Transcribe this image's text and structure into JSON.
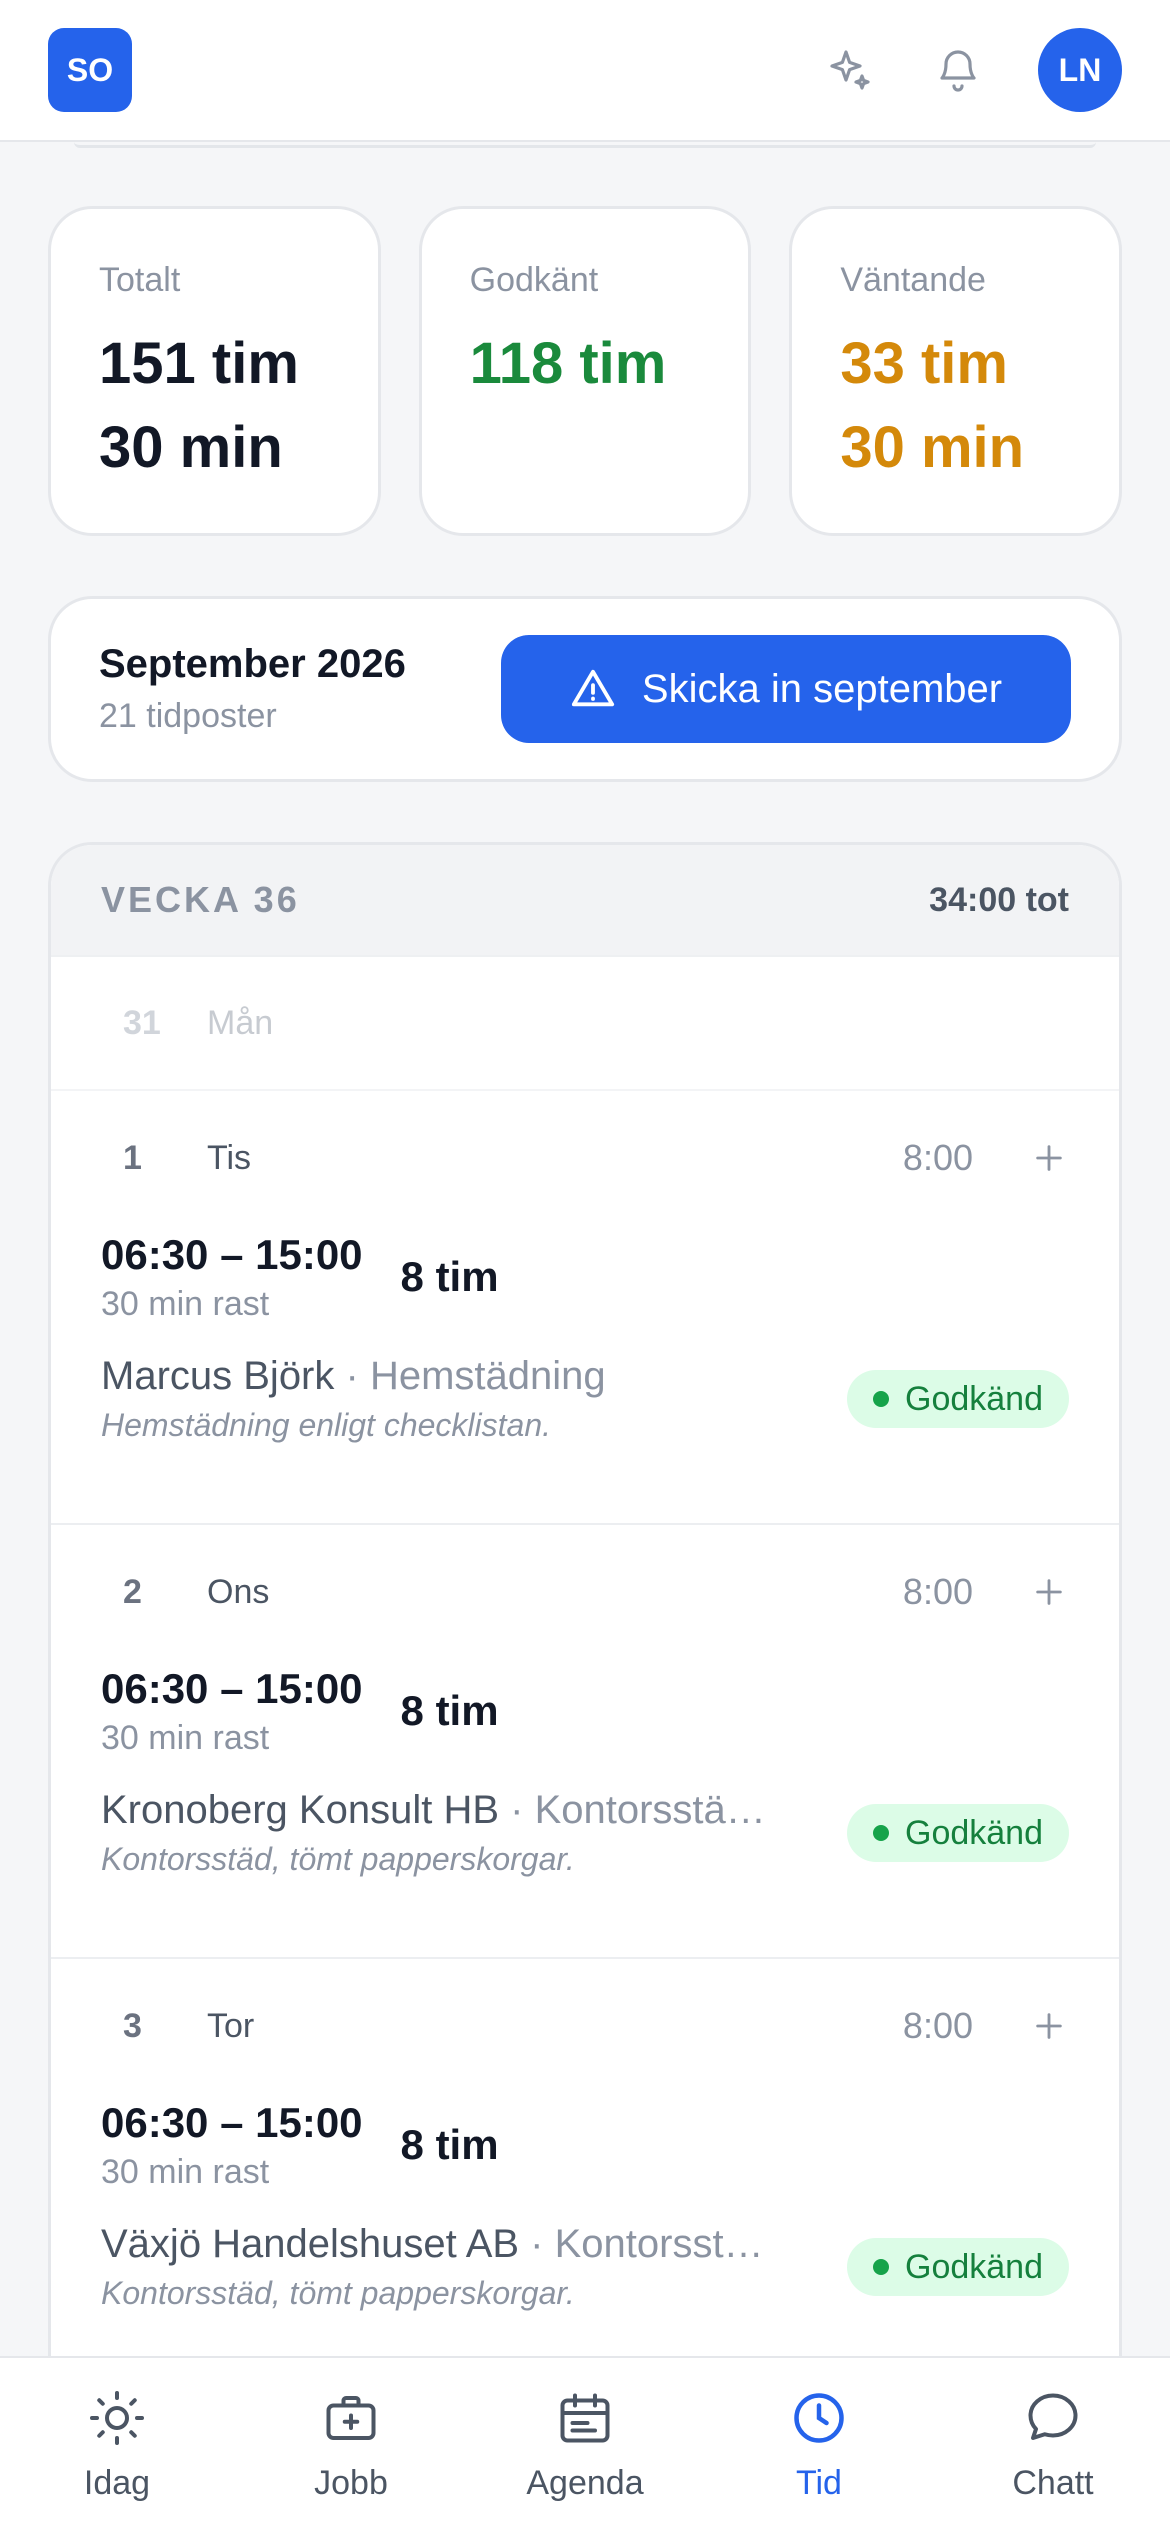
{
  "header": {
    "logo_text": "SO",
    "avatar_text": "LN",
    "icons": [
      "sparkles-icon",
      "bell-icon"
    ]
  },
  "summary": [
    {
      "label": "Totalt",
      "value_line1": "151 tim",
      "value_line2": "30 min",
      "color": "#121826"
    },
    {
      "label": "Godkänt",
      "value_line1": "118 tim",
      "value_line2": "",
      "color": "#1a8a3c"
    },
    {
      "label": "Väntande",
      "value_line1": "33 tim",
      "value_line2": "30 min",
      "color": "#d4890a"
    }
  ],
  "month": {
    "title": "September 2026",
    "subtitle": "21 tidposter",
    "submit_label": "Skicka in september",
    "submit_icon": "warning-triangle-icon"
  },
  "week": {
    "title": "VECKA 36",
    "total": "34:00 tot",
    "empty_day": {
      "num": "31",
      "name": "Mån"
    },
    "days": [
      {
        "num": "1",
        "name": "Tis",
        "hours": "8:00",
        "entry": {
          "time": "06:30 – 15:00",
          "rast": "30 min rast",
          "duration": "8 tim",
          "client": "Marcus Björk",
          "service": " · Hemstädning",
          "note": "Hemstädning enligt checklistan.",
          "status": "Godkänd"
        }
      },
      {
        "num": "2",
        "name": "Ons",
        "hours": "8:00",
        "entry": {
          "time": "06:30 – 15:00",
          "rast": "30 min rast",
          "duration": "8 tim",
          "client": "Kronoberg Konsult HB",
          "service": " · Kontorsstä…",
          "note": "Kontorsstäd, tömt papperskorgar.",
          "status": "Godkänd"
        }
      },
      {
        "num": "3",
        "name": "Tor",
        "hours": "8:00",
        "entry": {
          "time": "06:30 – 15:00",
          "rast": "30 min rast",
          "duration": "8 tim",
          "client": "Växjö Handelshuset AB",
          "service": " · Kontorsst…",
          "note": "Kontorsstäd, tömt papperskorgar.",
          "status": "Godkänd"
        }
      }
    ]
  },
  "nav": [
    {
      "label": "Idag",
      "icon": "sun-icon"
    },
    {
      "label": "Jobb",
      "icon": "briefcase-icon"
    },
    {
      "label": "Agenda",
      "icon": "calendar-icon"
    },
    {
      "label": "Tid",
      "icon": "clock-icon",
      "active": true
    },
    {
      "label": "Chatt",
      "icon": "chat-bubble-icon"
    }
  ],
  "colors": {
    "accent": "#2563eb",
    "approved": "#1a8a3c",
    "pending": "#d4890a",
    "badge_bg": "#dcfce7"
  }
}
